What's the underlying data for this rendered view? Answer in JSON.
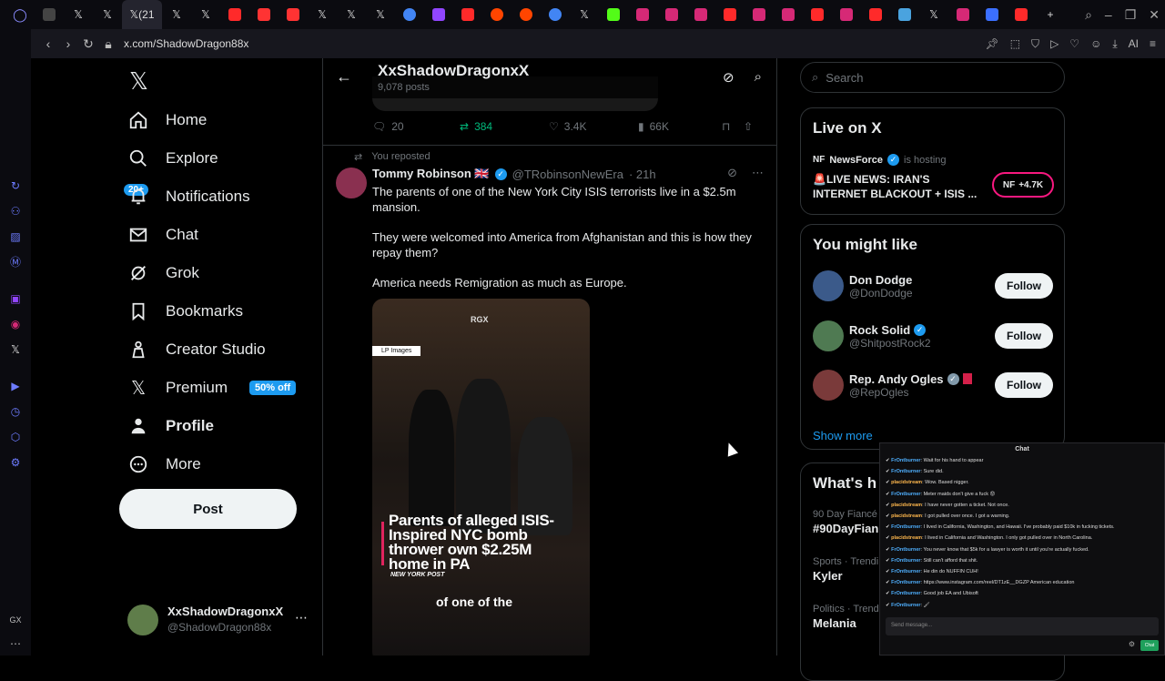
{
  "browser": {
    "url": "x.com/ShadowDragon88x",
    "active_tab_label": "(21",
    "ai_label": "AI",
    "gx_label": "GX"
  },
  "header": {
    "name": "XxShadowDragonxX",
    "post_count": "9,078 posts"
  },
  "nav": {
    "items": [
      {
        "label": "Home",
        "icon": "home-icon"
      },
      {
        "label": "Explore",
        "icon": "search-icon"
      },
      {
        "label": "Notifications",
        "icon": "bell-icon"
      },
      {
        "label": "Chat",
        "icon": "mail-icon"
      },
      {
        "label": "Grok",
        "icon": "grok-icon"
      },
      {
        "label": "Bookmarks",
        "icon": "bookmark-icon"
      },
      {
        "label": "Creator Studio",
        "icon": "creator-icon"
      },
      {
        "label": "Premium",
        "icon": "x-icon"
      },
      {
        "label": "Profile",
        "icon": "person-icon"
      },
      {
        "label": "More",
        "icon": "more-icon"
      }
    ],
    "notifications_badge": "20+",
    "premium_promo": "50% off",
    "post_button": "Post"
  },
  "account": {
    "name": "XxShadowDragonxX",
    "handle": "@ShadowDragon88x"
  },
  "prev_post_actions": {
    "replies": "20",
    "reposts": "384",
    "likes": "3.4K",
    "views": "66K"
  },
  "tweet": {
    "repost_label": "You reposted",
    "author_name": "Tommy Robinson 🇬🇧",
    "handle": "@TRobinsonNewEra",
    "time": "· 21h",
    "text1": "The parents of one of the New York City ISIS terrorists live in a $2.5m mansion.",
    "text2": "They were welcomed into America from Afghanistan and this is how they repay them?",
    "text3": "America needs Remigration as much as Europe.",
    "media": {
      "watermark": "RGX",
      "tag": "LP Images",
      "headline": "Parents of alleged ISIS-Inspired NYC bomb thrower own $2.25M home in PA",
      "source": "NEW YORK POST",
      "caption": "of one of the"
    }
  },
  "sidebar": {
    "search_placeholder": "Search",
    "live": {
      "title": "Live on X",
      "host": "NewsForce",
      "hosting": "is hosting",
      "stream_title": "🚨LIVE NEWS: IRAN'S INTERNET BLACKOUT + ISIS ...",
      "listeners": "+4.7K"
    },
    "wtf": {
      "title": "You might like",
      "users": [
        {
          "name": "Don Dodge",
          "handle": "@DonDodge",
          "button": "Follow"
        },
        {
          "name": "Rock Solid",
          "handle": "@ShitpostRock2",
          "button": "Follow"
        },
        {
          "name": "Rep. Andy Ogles",
          "handle": "@RepOgles",
          "button": "Follow"
        }
      ],
      "show_more": "Show more"
    },
    "trends": {
      "title": "What's h",
      "items": [
        {
          "category": "90 Day Fiancé",
          "name": "#90DayFian"
        },
        {
          "category": "Sports · Trendi",
          "name": "Kyler"
        },
        {
          "category": "Politics · Trend",
          "name": "Melania"
        }
      ]
    }
  },
  "chat_overlay": {
    "title": "Chat",
    "messages": [
      {
        "user": "FrOntburner",
        "text": "Wait for his hand to appear"
      },
      {
        "user": "FrOntburner",
        "text": "Sure did."
      },
      {
        "user": "placidstream",
        "text": "Wow. Based nigger."
      },
      {
        "user": "FrOntburner",
        "text": "Meter maids don't give a fuck 😡"
      },
      {
        "user": "placidstream",
        "text": "I have never gotten a ticket. Not once."
      },
      {
        "user": "placidstream",
        "text": "I got pulled over once. I got a warning."
      },
      {
        "user": "FrOntburner",
        "text": "I lived in California, Washington, and Hawaii. I've probably paid $10k in fucking tickets."
      },
      {
        "user": "placidstream",
        "text": "I lived in California and Washington. I only got pulled over in North Carolina."
      },
      {
        "user": "FrOntburner",
        "text": "You never know that $5k for a lawyer is worth it until you're actually fucked."
      },
      {
        "user": "FrOntburner",
        "text": "Still can't afford that shit."
      },
      {
        "user": "FrOntburner",
        "text": "He din do NUFFIN CUH!"
      },
      {
        "user": "FrOntburner",
        "text": "https://www.instagram.com/reel/DT1zE__DGZP American education"
      },
      {
        "user": "FrOntburner",
        "text": "Good job EA and Ubisoft"
      },
      {
        "user": "FrOntburner",
        "text": "🖌"
      }
    ],
    "input_placeholder": "Send message...",
    "send_button": "Chat"
  }
}
